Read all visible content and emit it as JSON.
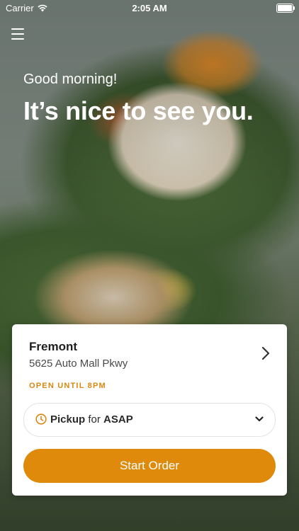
{
  "status_bar": {
    "carrier": "Carrier",
    "time": "2:05 AM"
  },
  "header": {
    "greeting": "Good morning!",
    "headline": "It’s nice to see you."
  },
  "store": {
    "name": "Fremont",
    "address": "5625 Auto Mall Pkwy",
    "hours": "OPEN UNTIL 8PM"
  },
  "order_mode": {
    "method": "Pickup",
    "connector": "for",
    "time": "ASAP"
  },
  "actions": {
    "start_order": "Start Order"
  },
  "colors": {
    "accent": "#e08a0c",
    "hours_text": "#d98710"
  },
  "icons": [
    "wifi-icon",
    "battery-icon",
    "menu-icon",
    "chevron-right-icon",
    "clock-icon",
    "chevron-down-icon"
  ]
}
